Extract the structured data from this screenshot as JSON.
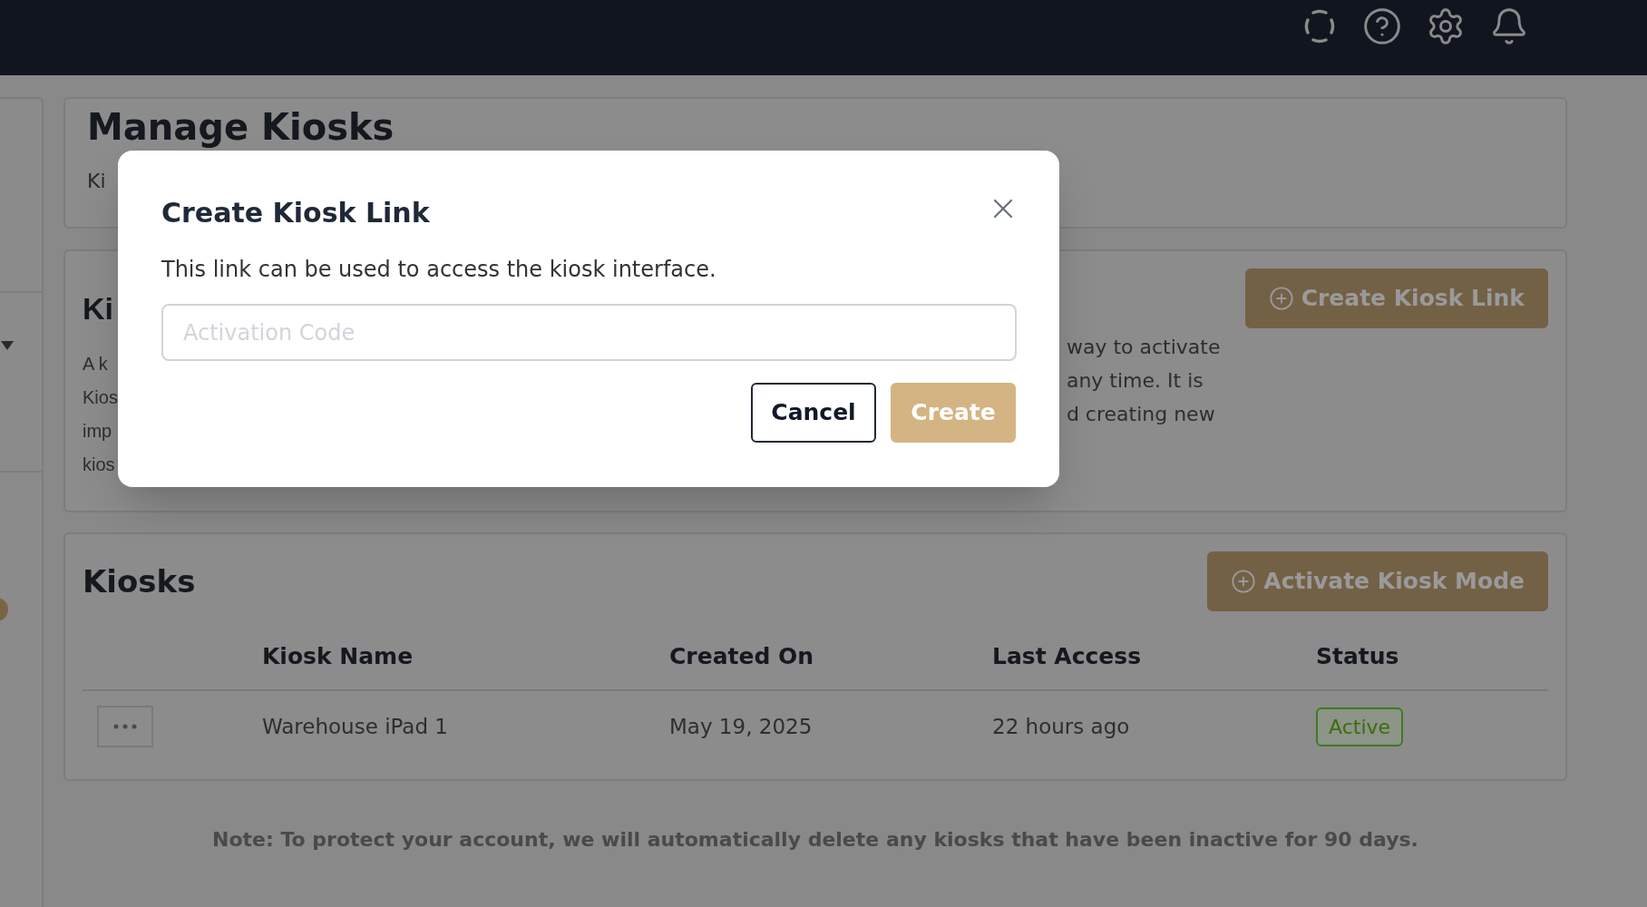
{
  "header_card": {
    "title": "Manage Kiosks",
    "subtitle": "Ki"
  },
  "links_card": {
    "heading": "Ki",
    "description_left": [
      "A k",
      "Kios",
      "imp",
      "kios"
    ],
    "description_right": [
      "way to activate",
      "any time. It is",
      "d creating new"
    ],
    "button": "Create Kiosk Link"
  },
  "kiosks_card": {
    "heading": "Kiosks",
    "button": "Activate Kiosk Mode",
    "columns": [
      "Kiosk Name",
      "Created On",
      "Last Access",
      "Status"
    ],
    "rows": [
      {
        "name": "Warehouse iPad 1",
        "created_on": "May 19, 2025",
        "last_access": "22 hours ago",
        "status": "Active"
      }
    ]
  },
  "note": "Note: To protect your account, we will automatically delete any kiosks that have been inactive for 90 days.",
  "dialog": {
    "title": "Create Kiosk Link",
    "description": "This link can be used to access the kiosk interface.",
    "input": {
      "placeholder": "Activation Code"
    },
    "buttons": [
      {
        "label": "Cancel",
        "kind": "secondary"
      },
      {
        "label": "Create",
        "kind": "primary"
      }
    ]
  }
}
